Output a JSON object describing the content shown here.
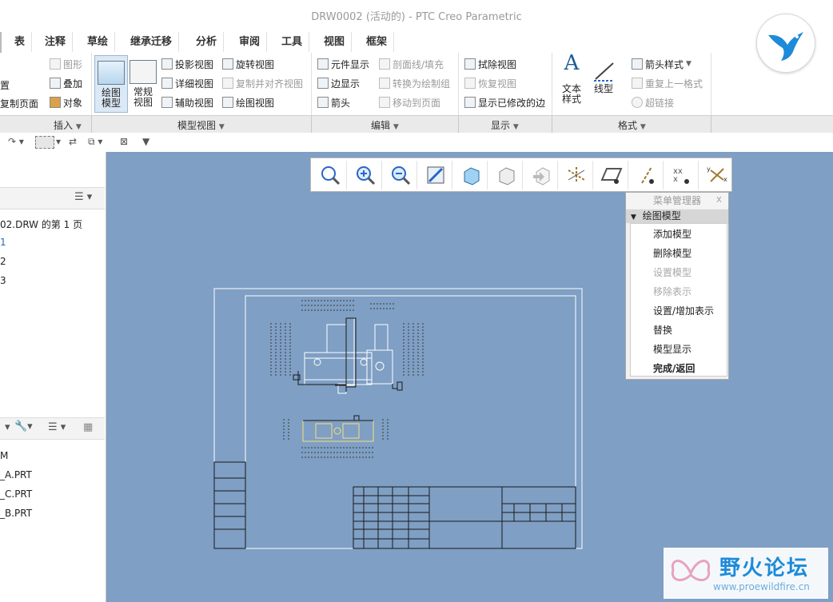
{
  "window": {
    "title": "DRW0002 (活动的) - PTC Creo Parametric"
  },
  "tabs": [
    "表",
    "注释",
    "草绘",
    "继承迁移",
    "分析",
    "审阅",
    "工具",
    "视图",
    "框架"
  ],
  "ribbon": {
    "insert_partial": [
      "置",
      "复制页面"
    ],
    "insert": {
      "graph": "图形",
      "overlay": "叠加",
      "object": "对象"
    },
    "model_view": {
      "drawing_model": "绘图\n模型",
      "general_view": "常规\n视图",
      "projection_view": "投影视图",
      "detail_view": "详细视图",
      "auxiliary_view": "辅助视图",
      "revolved_view": "旋转视图",
      "copy_align_view": "复制并对齐视图",
      "drawing_view": "绘图视图"
    },
    "edit": {
      "component_display": "元件显示",
      "edge_display": "边显示",
      "arrow": "箭头",
      "section_line_fill": "剖面线/填充",
      "convert_to_draw_group": "转换为绘制组",
      "move_to_page": "移动到页面"
    },
    "display": {
      "erase_view": "拭除视图",
      "resume_view": "恢复视图",
      "show_modified_edges": "显示已修改的边"
    },
    "format": {
      "text_style": "文本\n样式",
      "line_style": "线型",
      "arrow_style": "箭头样式",
      "repeat_last_format": "重复上一格式",
      "hyperlink": "超链接"
    },
    "groups": [
      "插入",
      "模型视图",
      "编辑",
      "显示",
      "格式"
    ]
  },
  "left_panel": {
    "sheet_title": "02.DRW 的第 1 页",
    "sheets": [
      "1",
      "2",
      "3"
    ],
    "models": [
      "M",
      "_A.PRT",
      "_C.PRT",
      "_B.PRT"
    ]
  },
  "menu_manager": {
    "title": "菜单管理器",
    "close": "x",
    "section": "绘图模型",
    "items": [
      {
        "label": "添加模型",
        "enabled": true
      },
      {
        "label": "删除模型",
        "enabled": true
      },
      {
        "label": "设置模型",
        "enabled": false
      },
      {
        "label": "移除表示",
        "enabled": false
      },
      {
        "label": "设置/增加表示",
        "enabled": true
      },
      {
        "label": "替换",
        "enabled": true
      },
      {
        "label": "模型显示",
        "enabled": true
      },
      {
        "label": "完成/返回",
        "enabled": true
      }
    ]
  },
  "watermark": {
    "text": "野火论坛",
    "url": "www.proewildfire.cn"
  },
  "colors": {
    "canvas": "#7f9fc4",
    "drawing_lines": "#ffffff",
    "title_block_lines": "#1a1a1a",
    "link": "#2a66c6"
  }
}
